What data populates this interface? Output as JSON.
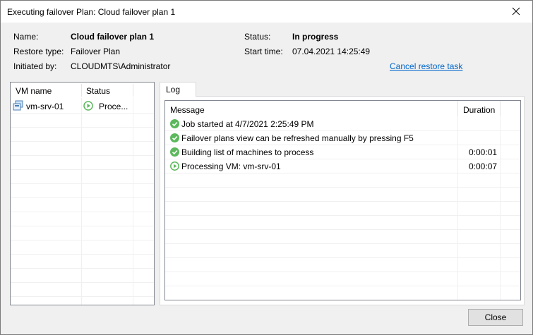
{
  "window": {
    "title": "Executing failover Plan: Cloud failover plan 1",
    "close_glyph": "✕"
  },
  "info": {
    "name_label": "Name:",
    "name_value": "Cloud failover plan 1",
    "restore_type_label": "Restore type:",
    "restore_type_value": "Failover Plan",
    "initiated_by_label": "Initiated by:",
    "initiated_by_value": "CLOUDMTS\\Administrator",
    "status_label": "Status:",
    "status_value": "In progress",
    "start_time_label": "Start time:",
    "start_time_value": "07.04.2021 14:25:49",
    "cancel_link": "Cancel restore task"
  },
  "vm_list": {
    "columns": [
      "VM name",
      "Status"
    ],
    "rows": [
      {
        "name": "vm-srv-01",
        "status": "Proce..."
      }
    ]
  },
  "tabs": [
    "Log"
  ],
  "log": {
    "columns": [
      "Message",
      "Duration"
    ],
    "rows": [
      {
        "icon": "success-check-icon",
        "message": "Job started at 4/7/2021 2:25:49 PM",
        "duration": ""
      },
      {
        "icon": "success-check-icon",
        "message": "Failover plans view can be refreshed manually by pressing F5",
        "duration": ""
      },
      {
        "icon": "success-check-icon",
        "message": "Building list of machines to process",
        "duration": "0:00:01"
      },
      {
        "icon": "in-progress-play-icon",
        "message": "Processing VM: vm-srv-01",
        "duration": "0:00:07"
      }
    ]
  },
  "footer": {
    "close_label": "Close"
  },
  "colors": {
    "success": "#5cb85c",
    "link": "#0066cc"
  }
}
